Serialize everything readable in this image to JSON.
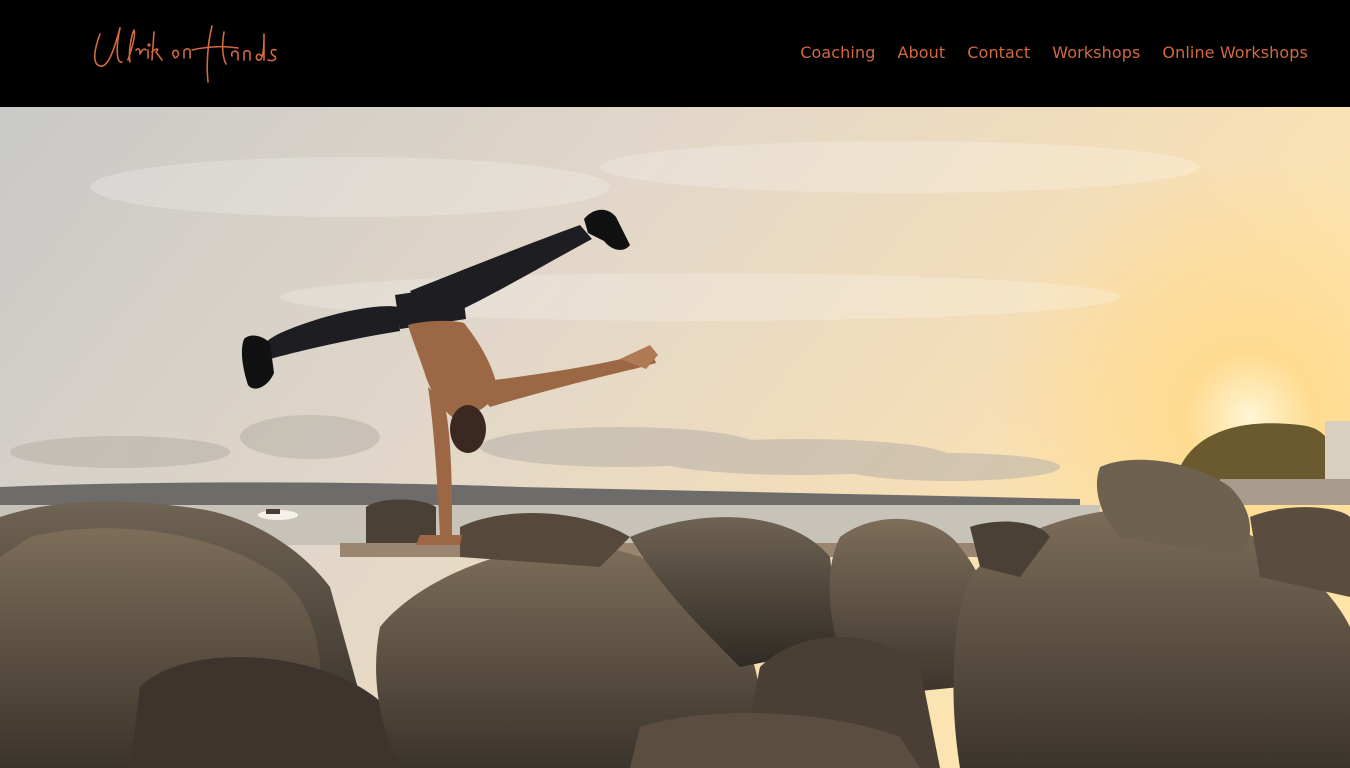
{
  "header": {
    "logo_text": "Ulrik on Hands",
    "nav": [
      {
        "label": "Coaching"
      },
      {
        "label": "About"
      },
      {
        "label": "Contact"
      },
      {
        "label": "Workshops"
      },
      {
        "label": "Online Workshops"
      }
    ],
    "accent_color": "#d2693f"
  },
  "hero": {
    "image": "man-handstand-on-beach-rocks-at-sunset"
  }
}
